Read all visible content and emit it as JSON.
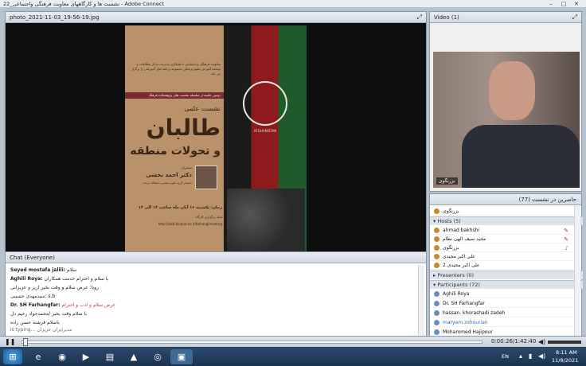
{
  "window": {
    "title": "22_نشست ها و کارگاههای معاونت فرهنگی واجتماعی - Adobe Connect",
    "controls": [
      "–",
      "□",
      "✕"
    ]
  },
  "share_pod": {
    "title": "photo_2021-11-03_19-56-19.jpg",
    "poster": {
      "intro": "معاونت فرهنگی و اجتماعی با همکاری مدیریت مرکز مطالعات و توسعه آموزش علوم پزشکی مجموعه برنامه های آموزشی را برگزار می کند",
      "banner": "دومین جلسه از سلسله نشست های پژوهشکده فرهنگ",
      "heading_small": "نشست علمی",
      "heading_big": "طالبان",
      "heading_sub": "و تحولات منطقه",
      "speaker_label": "سخنران",
      "speaker_name": "دکتر احمد بخشی",
      "speaker_role": "دانشیار گروه علوم سیاسی دانشگاه بیرجند",
      "time": "زمان: یکشنبه ۱۶ آبان ماه ساعت ۱۲ الی ۱۴",
      "place": "لینک برگزاری کارگاه",
      "link": "http://iac8.birjand.ac.ir/farhangimeeting",
      "flag_text": "AFGHANISTAN"
    }
  },
  "video_pod": {
    "title": "Video",
    "count": "(1)",
    "participant_label": "بزرنگوی"
  },
  "attendees_pod": {
    "title": "حاضرین در نشست",
    "count": "(77)",
    "self": "بزرنگوی",
    "hosts_label": "Hosts (5)",
    "hosts": [
      "ahmad bakhshi",
      "مجید سیف الهی نظام",
      "بزرنگوی",
      "علی اکبر مجیدی",
      "علی اکبر مجیدی 2"
    ],
    "presenters_label": "Presenters (0)",
    "participants_label": "Participants (72)",
    "participants": [
      "Aghili Roya",
      "Dr. SH Farhangfar",
      "hassan. khorashadi zadeh",
      "maryam zohourian",
      "Mohammed Hajipour"
    ]
  },
  "chat_pod": {
    "title": "Chat",
    "scope": "(Everyone)",
    "messages": [
      {
        "sender": "Seyed mostafa jalili:",
        "text": "سلام"
      },
      {
        "sender": "Aghili Roya:",
        "text": "با سلام و احترام خدمت همکاران"
      },
      {
        "sender": "",
        "text": "رویا: عرض سلام و وقت بخیر ازیز و عزیزانی"
      },
      {
        "sender": "",
        "text": "سیدمهدی حسینی: s.b"
      },
      {
        "sender": "Dr. SH Farhangfar:",
        "text": "عرض سلام و ادب و احترام"
      },
      {
        "sender": "",
        "text": "با سلام وقت بخیر /محمدجواد رحیم دل"
      },
      {
        "sender": "",
        "text": "باسلام فرشته حسن زاده"
      },
      {
        "sender": "",
        "text": "is typing... مدیرایران عزیزان"
      }
    ]
  },
  "player": {
    "time": "0:00:26/1:42:40",
    "progress": 0.004
  },
  "taskbar": {
    "lang": "EN",
    "clock_time": "8:11 AM",
    "clock_date": "11/8/2021"
  }
}
